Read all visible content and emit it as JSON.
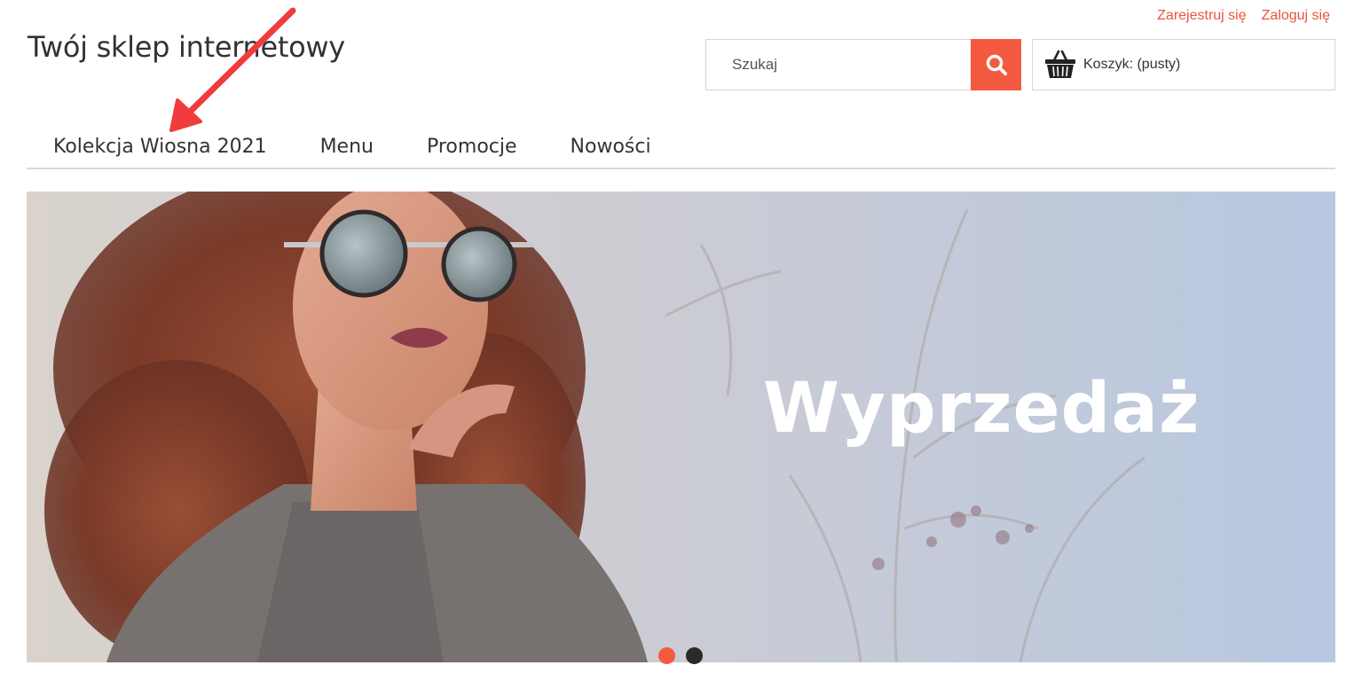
{
  "header": {
    "register_label": "Zarejestruj się",
    "login_label": "Zaloguj się",
    "shop_title": "Twój sklep internetowy"
  },
  "search": {
    "placeholder": "Szukaj",
    "value": "",
    "button_icon": "search-icon"
  },
  "cart": {
    "icon": "basket-icon",
    "label": "Koszyk: (pusty)"
  },
  "nav": {
    "items": [
      {
        "label": "Kolekcja Wiosna 2021"
      },
      {
        "label": "Menu"
      },
      {
        "label": "Promocje"
      },
      {
        "label": "Nowości"
      }
    ]
  },
  "hero": {
    "caption": "Wyprzedaż",
    "slides_count": 2,
    "active_slide": 1
  },
  "colors": {
    "accent": "#f35a40",
    "link": "#e8553f",
    "text": "#333333",
    "dot_active": "#f35a40",
    "dot_inactive": "#2a2a2a",
    "annotation": "#f03c3c"
  }
}
